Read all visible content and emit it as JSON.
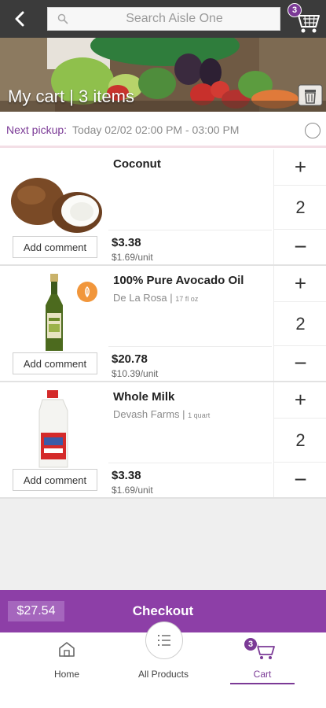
{
  "header": {
    "search_placeholder": "Search Aisle One",
    "cart_count": "3"
  },
  "banner": {
    "title": "My cart | 3 items"
  },
  "pickup": {
    "label": "Next pickup:",
    "time": "Today 02/02 02:00 PM - 03:00 PM"
  },
  "items": [
    {
      "name": "Coconut",
      "brand": "",
      "size": "",
      "price": "$3.38",
      "unit_price": "$1.69/unit",
      "quantity": "2",
      "comment_label": "Add comment"
    },
    {
      "name": "100% Pure Avocado Oil",
      "brand": "De La Rosa",
      "separator": "|",
      "size": "17 fl oz",
      "price": "$20.78",
      "unit_price": "$10.39/unit",
      "quantity": "2",
      "comment_label": "Add comment"
    },
    {
      "name": "Whole Milk",
      "brand": "Devash Farms",
      "separator": "|",
      "size": "1 quart",
      "price": "$3.38",
      "unit_price": "$1.69/unit",
      "quantity": "2",
      "comment_label": "Add comment"
    }
  ],
  "qty_controls": {
    "plus": "+",
    "minus": "−"
  },
  "checkout": {
    "total": "$27.54",
    "label": "Checkout"
  },
  "nav": {
    "home": "Home",
    "all_products": "All Products",
    "cart": "Cart",
    "cart_count": "3"
  },
  "colors": {
    "accent": "#8d3fa7",
    "header": "#3b3b3b",
    "diet_badge": "#f1963b"
  }
}
